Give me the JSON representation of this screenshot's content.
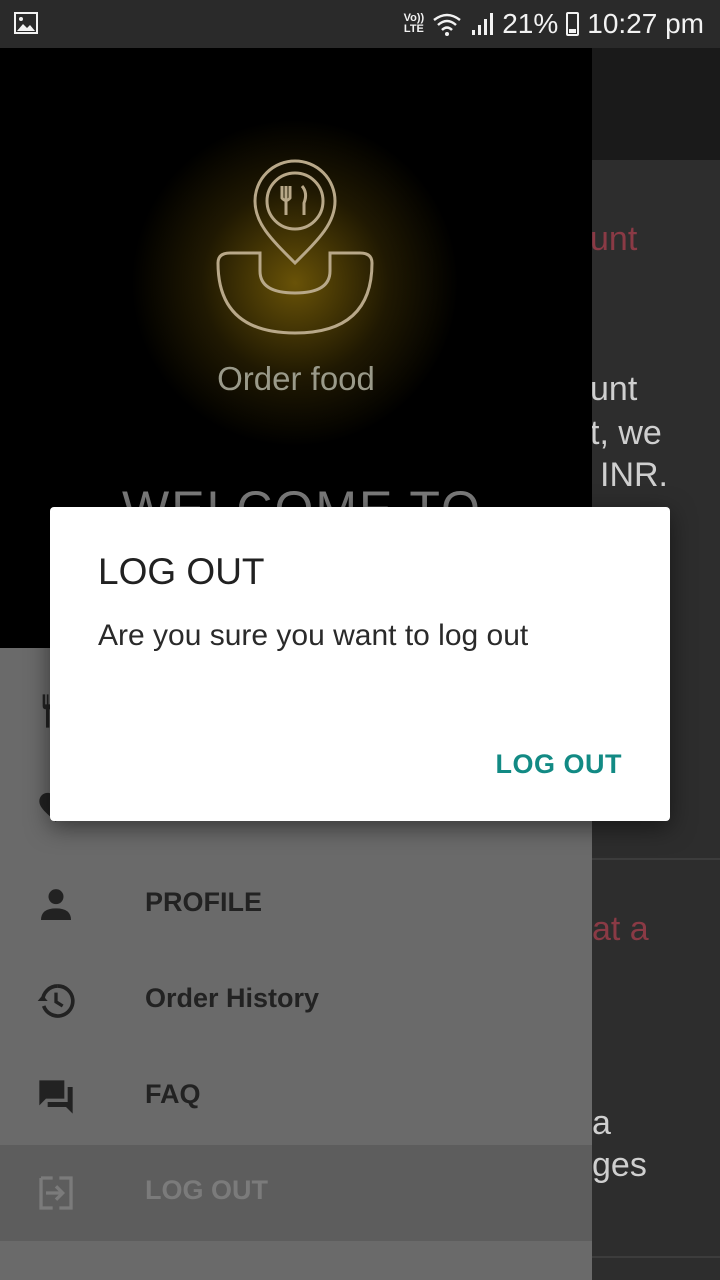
{
  "status_bar": {
    "network_label_top": "Vo))",
    "network_label_bottom": "LTE",
    "battery": "21%",
    "time": "10:27 pm"
  },
  "background": {
    "line1": "unt",
    "line2": "unt",
    "line3": "t, we",
    "line4": "INR.",
    "line5": "at a",
    "line6": "a",
    "line7": "ges"
  },
  "drawer": {
    "logo_text": "Order food",
    "welcome_text": "WELCOME TO",
    "items": [
      {
        "label": "",
        "icon": "restaurant-icon"
      },
      {
        "label": "",
        "icon": "heart-icon"
      },
      {
        "label": "PROFILE",
        "icon": "person-icon"
      },
      {
        "label": "Order History",
        "icon": "history-icon"
      },
      {
        "label": "FAQ",
        "icon": "forum-icon"
      },
      {
        "label": "LOG OUT",
        "icon": "logout-icon"
      }
    ]
  },
  "dialog": {
    "title": "LOG OUT",
    "message": "Are you sure you want to log out",
    "confirm_label": "LOG OUT"
  },
  "colors": {
    "accent": "#128a84",
    "drawer_header": "#000000",
    "logo_glow": "#8c6e0a"
  }
}
